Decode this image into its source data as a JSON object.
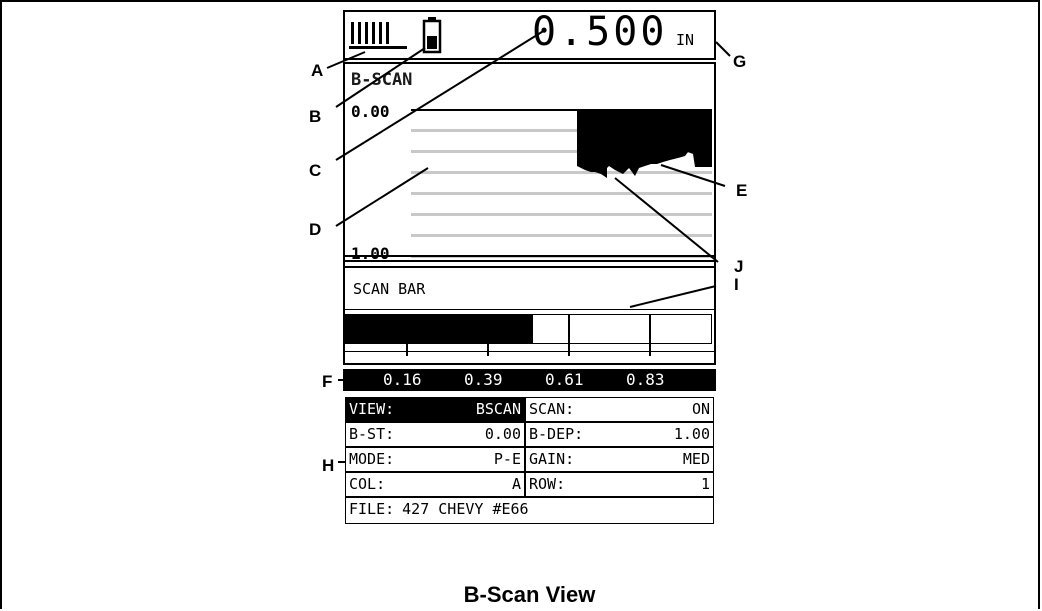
{
  "header": {
    "battery_bars": "IIIIII",
    "reading_value": "0.500",
    "reading_unit": "IN"
  },
  "bscan": {
    "title": "B-SCAN",
    "top_depth": "0.00",
    "bottom_depth": "1.00"
  },
  "scan_bar": {
    "label": "SCAN BAR",
    "fill_fraction": 0.51,
    "readouts": [
      "0.16",
      "0.39",
      "0.61",
      "0.83"
    ]
  },
  "settings": {
    "rows": [
      {
        "left_key": "VIEW:",
        "left_val": "BSCAN",
        "right_key": "SCAN:",
        "right_val": "ON"
      },
      {
        "left_key": "B-ST:",
        "left_val": "0.00",
        "right_key": "B-DEP:",
        "right_val": "1.00"
      },
      {
        "left_key": "MODE:",
        "left_val": "P-E",
        "right_key": "GAIN:",
        "right_val": "MED"
      },
      {
        "left_key": "COL:",
        "left_val": "A",
        "right_key": "ROW:",
        "right_val": "1"
      }
    ],
    "file_key": "FILE:",
    "file_val": "427 CHEVY #E66"
  },
  "callouts": {
    "A": "A",
    "B": "B",
    "C": "C",
    "D": "D",
    "E": "E",
    "F": "F",
    "G": "G",
    "H": "H",
    "I": "I",
    "J": "J"
  },
  "caption": "B-Scan View"
}
